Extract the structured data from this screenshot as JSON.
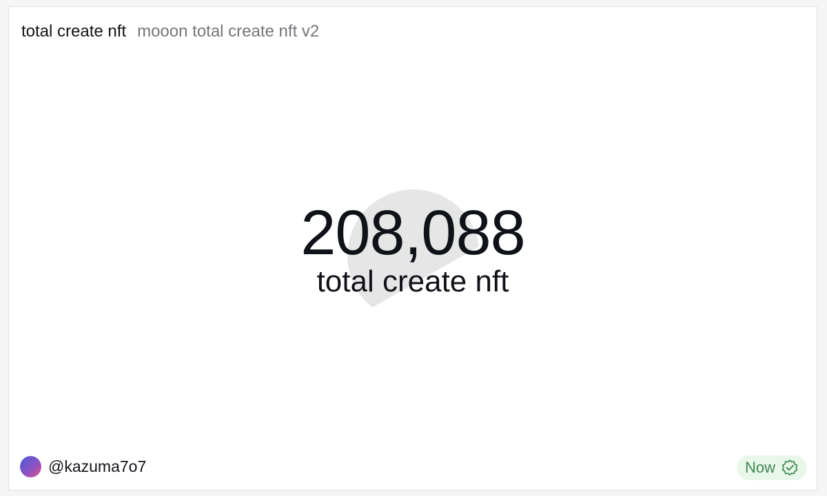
{
  "header": {
    "title": "total create nft",
    "subtitle": "mooon total create nft v2"
  },
  "counter": {
    "value": "208,088",
    "label": "total create nft"
  },
  "footer": {
    "username": "@kazuma7o7",
    "status": "Now",
    "status_icon": "verified-check-icon",
    "avatar_icon": "user-avatar"
  },
  "colors": {
    "status_bg": "#e9f6ea",
    "status_fg": "#3f8a50",
    "watermark": "#e6e6e6"
  }
}
